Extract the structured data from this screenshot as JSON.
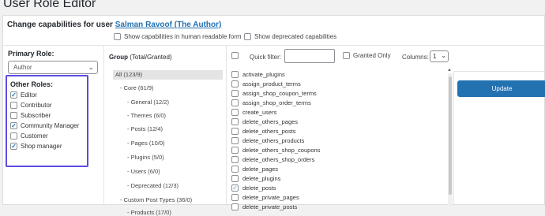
{
  "page_title": "User Role Editor",
  "change_caps": {
    "prefix": "Change capabilities for user ",
    "user_link": "Salman Ravoof (The Author)"
  },
  "options": {
    "human_readable": "Show capabilities in human readable form",
    "deprecated": "Show deprecated capabilities"
  },
  "primary_role": {
    "label": "Primary Role:",
    "value": "Author"
  },
  "other_roles": {
    "label": "Other Roles:",
    "roles": [
      {
        "label": "Editor",
        "checked": true
      },
      {
        "label": "Contributor",
        "checked": false
      },
      {
        "label": "Subscriber",
        "checked": false
      },
      {
        "label": "Community Manager",
        "checked": true
      },
      {
        "label": "Customer",
        "checked": false
      },
      {
        "label": "Shop manager",
        "checked": true
      }
    ]
  },
  "group": {
    "title": "Group",
    "subtitle": "(Total/Granted)",
    "items": [
      {
        "label": "All (123/9)"
      },
      {
        "label": "- Core (61/9)"
      },
      {
        "label": "- General (12/2)"
      },
      {
        "label": "- Themes (6/0)"
      },
      {
        "label": "- Posts (12/4)"
      },
      {
        "label": "- Pages (10/0)"
      },
      {
        "label": "- Plugins (5/0)"
      },
      {
        "label": "- Users (6/0)"
      },
      {
        "label": "- Deprecated (12/3)"
      },
      {
        "label": "- Custom Post Types (36/0)"
      },
      {
        "label": "- Products (17/0)"
      }
    ]
  },
  "filter": {
    "label": "Quick filter:",
    "value": "",
    "granted_only": "Granted Only",
    "columns_label": "Columns:",
    "columns_value": "1"
  },
  "capabilities": [
    {
      "label": "activate_plugins",
      "checked": false
    },
    {
      "label": "assign_product_terms",
      "checked": false
    },
    {
      "label": "assign_shop_coupon_terms",
      "checked": false
    },
    {
      "label": "assign_shop_order_terms",
      "checked": false
    },
    {
      "label": "create_users",
      "checked": false
    },
    {
      "label": "delete_others_pages",
      "checked": false
    },
    {
      "label": "delete_others_posts",
      "checked": false
    },
    {
      "label": "delete_others_products",
      "checked": false
    },
    {
      "label": "delete_others_shop_coupons",
      "checked": false
    },
    {
      "label": "delete_others_shop_orders",
      "checked": false
    },
    {
      "label": "delete_pages",
      "checked": false
    },
    {
      "label": "delete_plugins",
      "checked": false
    },
    {
      "label": "delete_posts",
      "checked": true
    },
    {
      "label": "delete_private_pages",
      "checked": false
    },
    {
      "label": "delete_private_posts",
      "checked": false
    }
  ],
  "update_button": "Update",
  "colors": {
    "accent": "#2271b1",
    "highlight_border": "#5b4ce0"
  }
}
